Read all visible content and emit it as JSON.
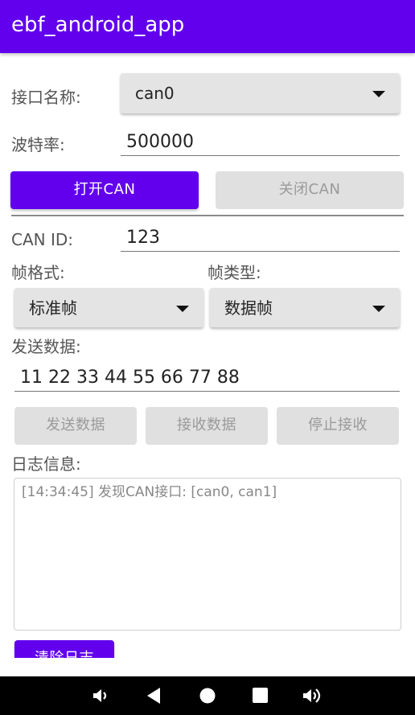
{
  "app_title": "ebf_android_app",
  "interface": {
    "label": "接口名称:",
    "selected": "can0"
  },
  "baud": {
    "label": "波特率:",
    "value": "500000"
  },
  "buttons": {
    "open_can": "打开CAN",
    "close_can": "关闭CAN"
  },
  "can_id": {
    "label": "CAN ID:",
    "value": "123"
  },
  "frame_format": {
    "label": "帧格式:",
    "selected": "标准帧"
  },
  "frame_type": {
    "label": "帧类型:",
    "selected": "数据帧"
  },
  "send_data": {
    "label": "发送数据:",
    "value": "11 22 33 44 55 66 77 88"
  },
  "actions": {
    "send": "发送数据",
    "receive": "接收数据",
    "stop": "停止接收"
  },
  "log": {
    "label": "日志信息:",
    "text": "[14:34:45] 发现CAN接口: [can0, can1]",
    "clear_button": "清除日志"
  },
  "colors": {
    "primary": "#6200ee",
    "disabled_bg": "#e0e0e0",
    "disabled_text": "#9a9a9a"
  },
  "navbar_icons": [
    "volume-down-icon",
    "back-icon",
    "home-icon",
    "recents-icon",
    "volume-up-icon"
  ]
}
